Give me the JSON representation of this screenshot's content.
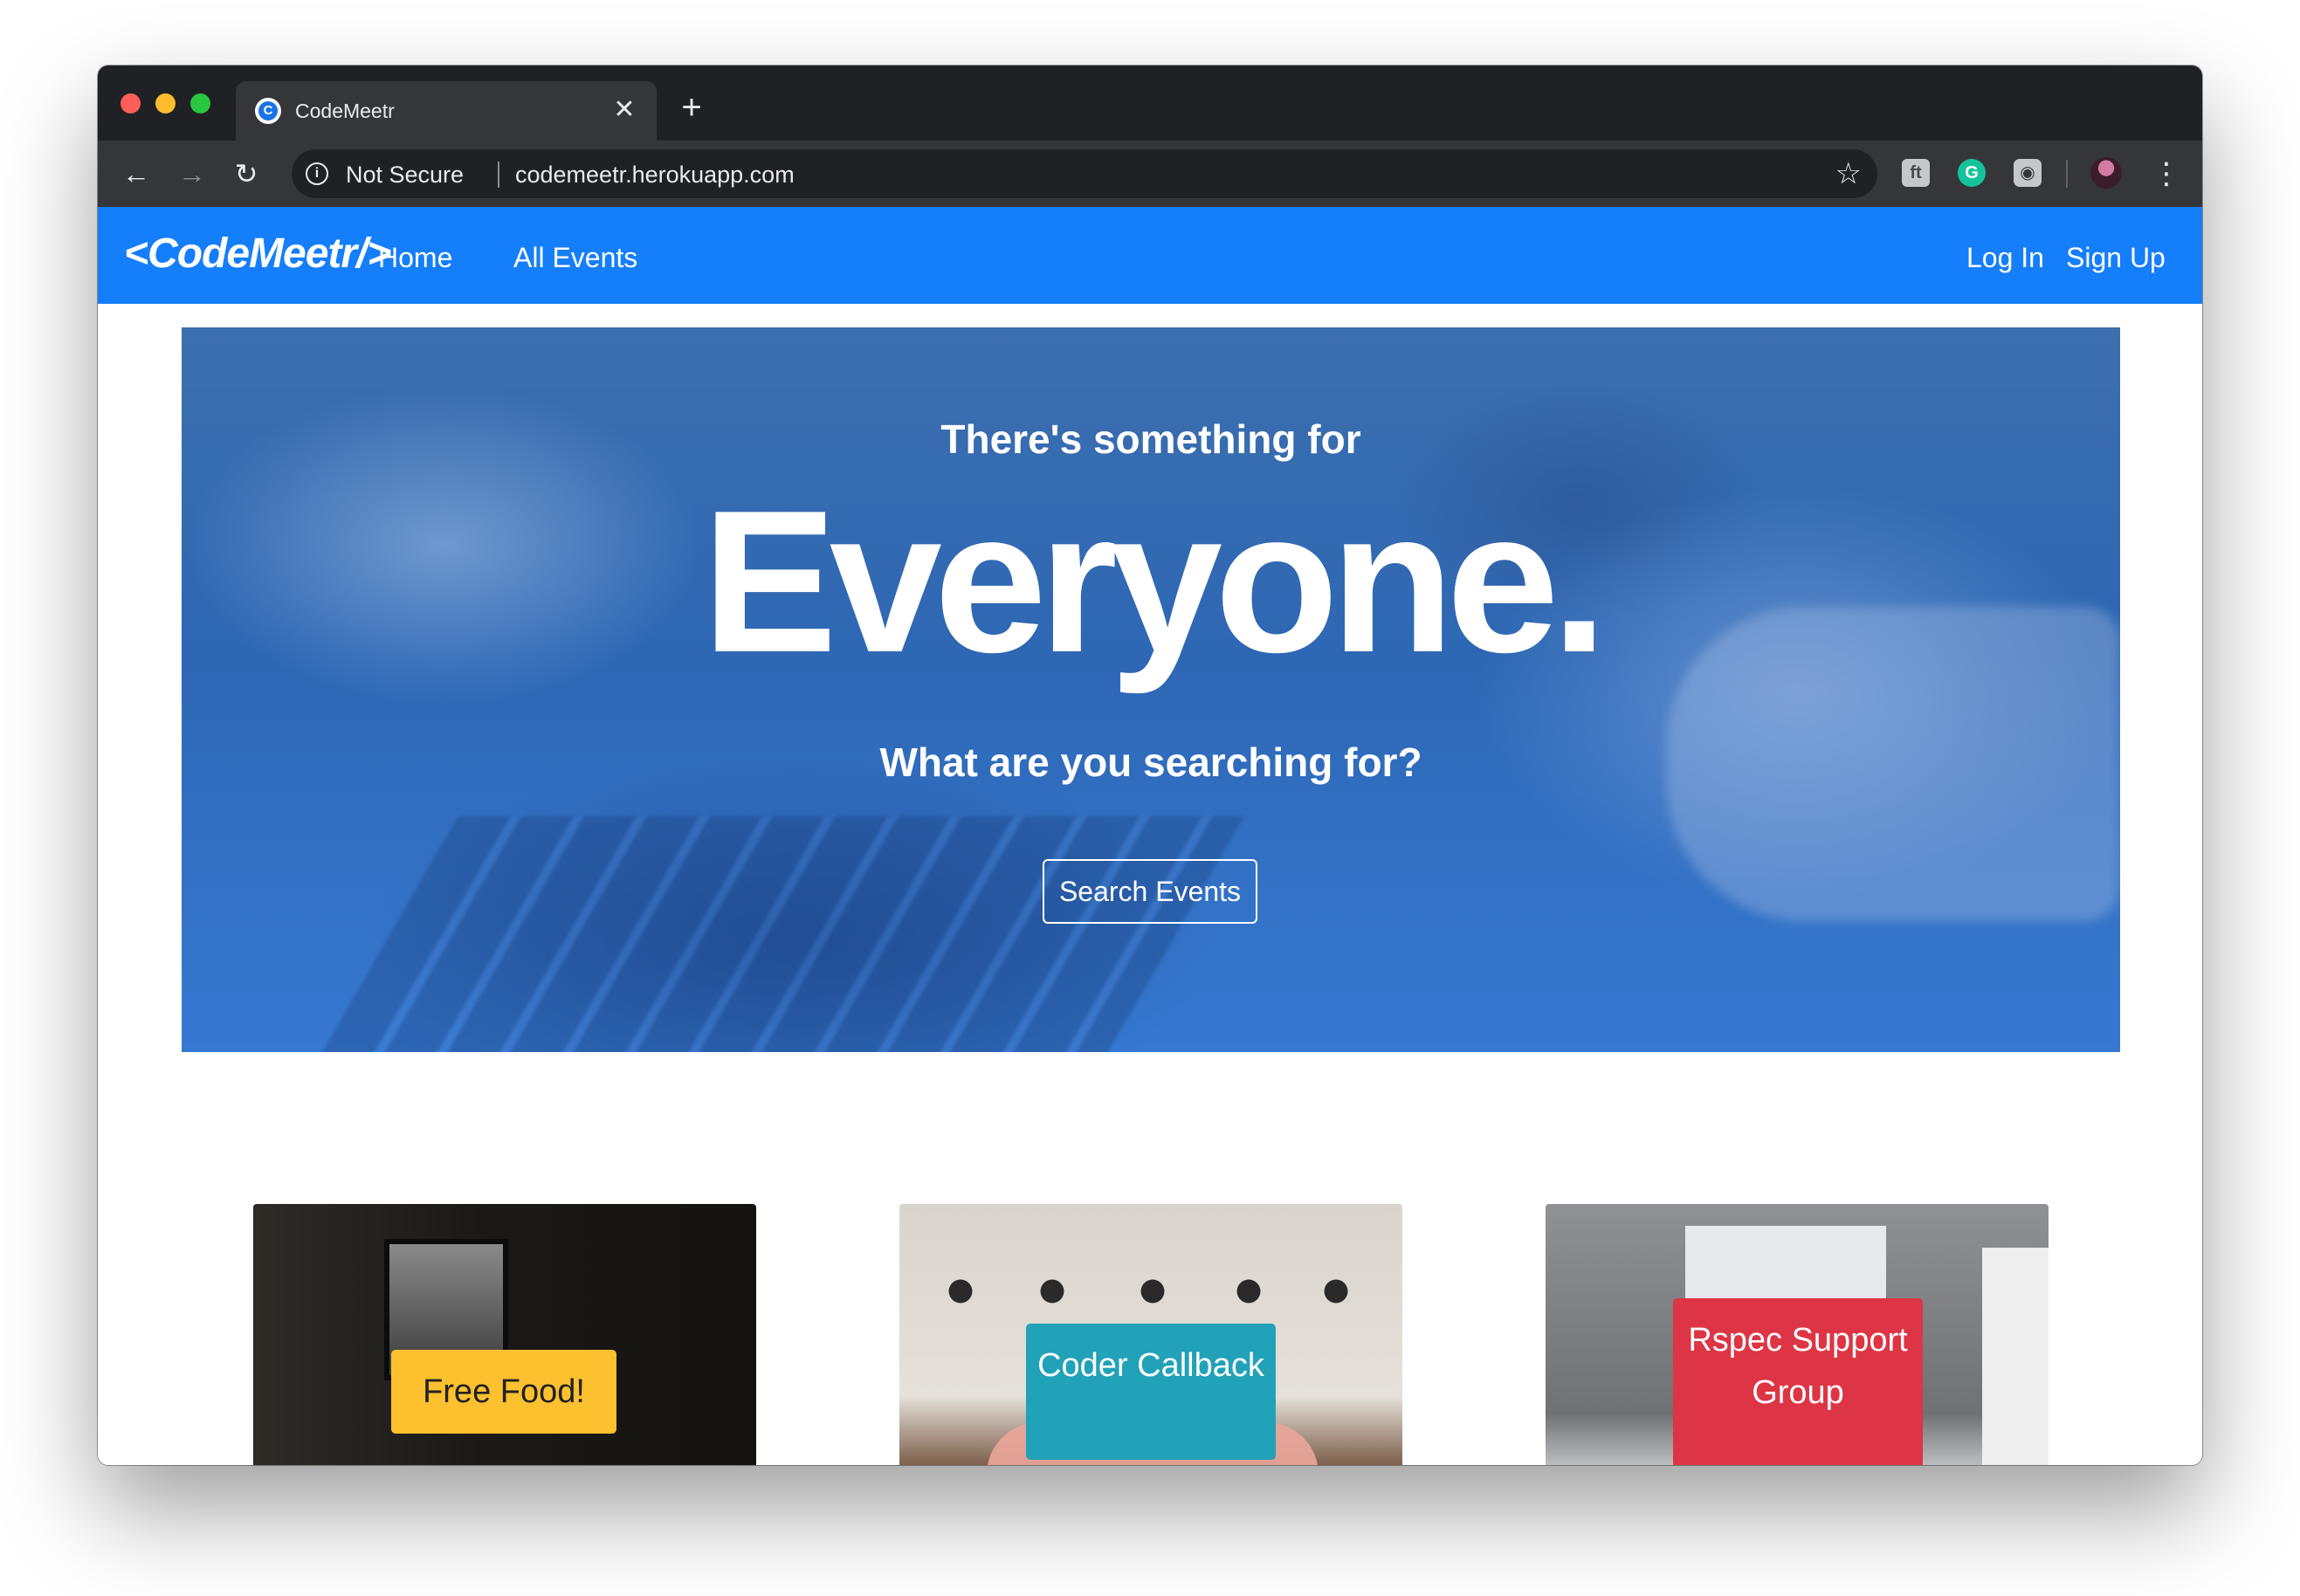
{
  "browser": {
    "tab_title": "CodeMeetr",
    "tab_close": "✕",
    "new_tab": "+",
    "security_label": "Not Secure",
    "url": "codemeetr.herokuapp.com",
    "favicon_letter": "C"
  },
  "navbar": {
    "brand": "<CodeMeetr/>",
    "links": [
      "Home",
      "All Events"
    ],
    "auth_links": [
      "Log In",
      "Sign Up"
    ],
    "color": "#157efb"
  },
  "hero": {
    "kicker": "There's something for",
    "title": "Everyone.",
    "subtitle": "What are you searching for?",
    "button_label": "Search Events"
  },
  "cards": [
    {
      "label": "Free Food!",
      "color": "#fdc02f"
    },
    {
      "label": "Coder Callback",
      "color": "#21a2b8"
    },
    {
      "label": "Rspec Support Group",
      "color": "#dd3545"
    }
  ]
}
